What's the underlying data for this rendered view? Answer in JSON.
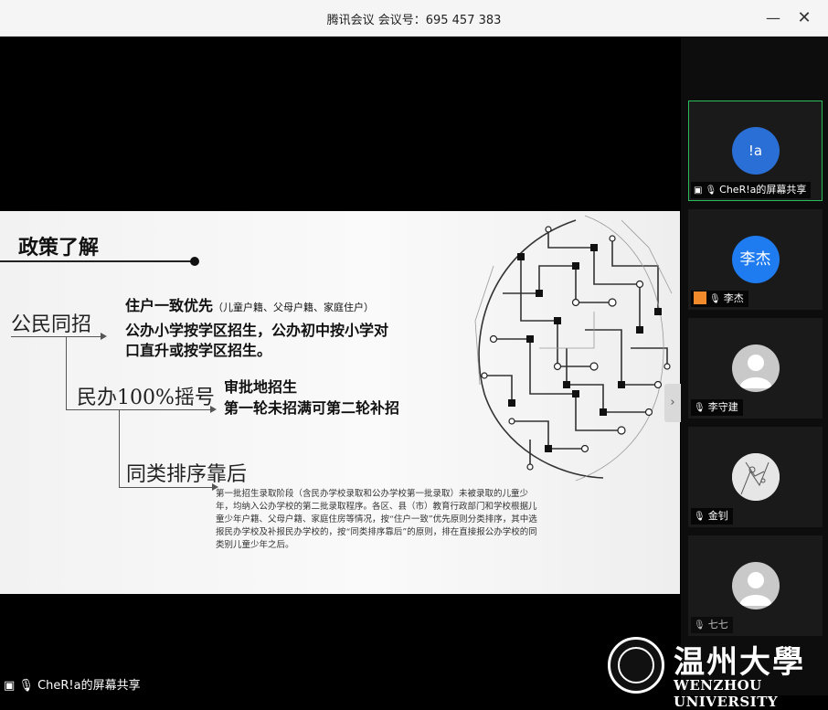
{
  "window": {
    "title": "腾讯会议 会议号：695 457 383"
  },
  "slide": {
    "heading": "政策了解",
    "branch1": "公民同招",
    "branch1_title": "住户一致优先",
    "branch1_title_note": "（儿童户籍、父母户籍、家庭住户）",
    "branch1_desc": [
      "公办小学按学区招生，公办初中按小学对",
      "口直升或按学区招生。"
    ],
    "branch2": "民办100%摇号",
    "branch2_desc": [
      "审批地招生",
      "第一轮未招满可第二轮补招"
    ],
    "branch3": "同类排序靠后",
    "note": "第一批招生录取阶段（含民办学校录取和公办学校第一批录取）未被录取的儿童少年，均纳入公办学校的第二批录取程序。各区、县（市）教育行政部门和学校根据儿童少年户籍、父母户籍、家庭住房等情况，按“住户一致”优先原则分类排序，其中选报民办学校及补报民办学校的，按“同类排序靠后”的原则，排在直接报公办学校的同类别儿童少年之后。"
  },
  "participants": [
    {
      "avatar_text": "!a",
      "label": "CheR!a的屏幕共享",
      "active": true
    },
    {
      "avatar_text": "李杰",
      "label": "李杰"
    },
    {
      "avatar_text": "",
      "label": "李守建"
    },
    {
      "avatar_text": "",
      "label": "金钊"
    },
    {
      "avatar_text": "",
      "label": "七七"
    }
  ],
  "share_label": "CheR!a的屏幕共享",
  "logo": {
    "cn": "温州大學",
    "en": "WENZHOU UNIVERSITY"
  },
  "colors": {
    "active_border": "#2bbd5a",
    "avatar_blue": "#1f7cf0"
  }
}
